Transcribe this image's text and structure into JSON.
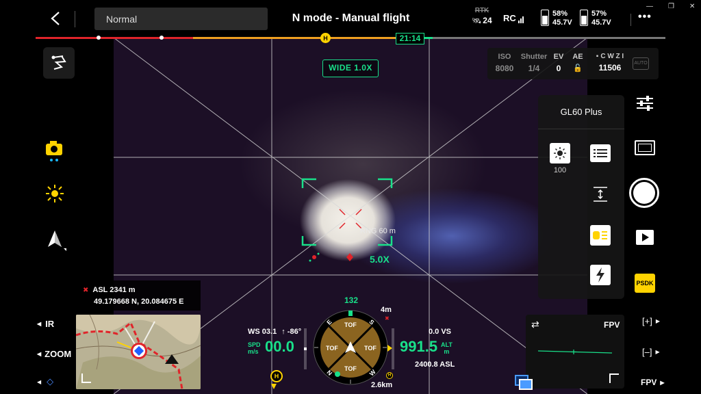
{
  "top": {
    "mode_field": "Normal",
    "title": "N mode - Manual flight",
    "rtk_label": "RTK",
    "satellites": "24",
    "rc_label": "RC",
    "battery1": {
      "percent": "58%",
      "voltage": "45.7V"
    },
    "battery2": {
      "percent": "57%",
      "voltage": "45.7V"
    },
    "more": "•••"
  },
  "timeline": {
    "home_marker": "H",
    "time_remaining": "21:14"
  },
  "camera_settings": {
    "iso_label": "ISO",
    "iso_value": "8080",
    "shutter_label": "Shutter",
    "shutter_value": "1/4",
    "ev_label": "EV",
    "ev_value": "0",
    "ae_label": "AE",
    "storage_label": "C W Z I",
    "storage_value": "11506",
    "auto_label": "AUTO"
  },
  "lens": {
    "zoom_badge": "WIDE 1.0X",
    "target_range": "RNG 60 m",
    "zoom_level": "5.0X"
  },
  "location": {
    "asl": "ASL 2341 m",
    "coords": "49.179668 N, 20.084675 E"
  },
  "left_controls": {
    "ir": "IR",
    "zoom": "ZOOM"
  },
  "psdk_panel": {
    "title": "GL60 Plus",
    "brightness_value": "100"
  },
  "right_controls": {
    "psdk_label": "PSDK",
    "plus": "[+]",
    "minus": "[–]",
    "fpv": "FPV"
  },
  "fpv": {
    "label": "FPV"
  },
  "telemetry": {
    "ws": "WS 03.1",
    "ws_dir": "↑ -86°",
    "spd_label": "SPD",
    "spd_unit": "m/s",
    "speed": "00.0",
    "vs": "0.0 VS",
    "altitude": "991.5",
    "alt_label": "ALT",
    "alt_unit": "m",
    "asl_alt": "2400.8 ASL",
    "heading": "132",
    "distance_top": "4m",
    "distance_bottom": "2.6km",
    "tof": [
      "TOF",
      "TOF",
      "TOF",
      "TOF"
    ],
    "home_marker": "H",
    "compass_n": "N",
    "compass_e": "E",
    "compass_s": "S",
    "compass_w": "W"
  },
  "colors": {
    "accent_green": "#19e08a",
    "yellow": "#ffd300",
    "red": "#e0242a"
  }
}
